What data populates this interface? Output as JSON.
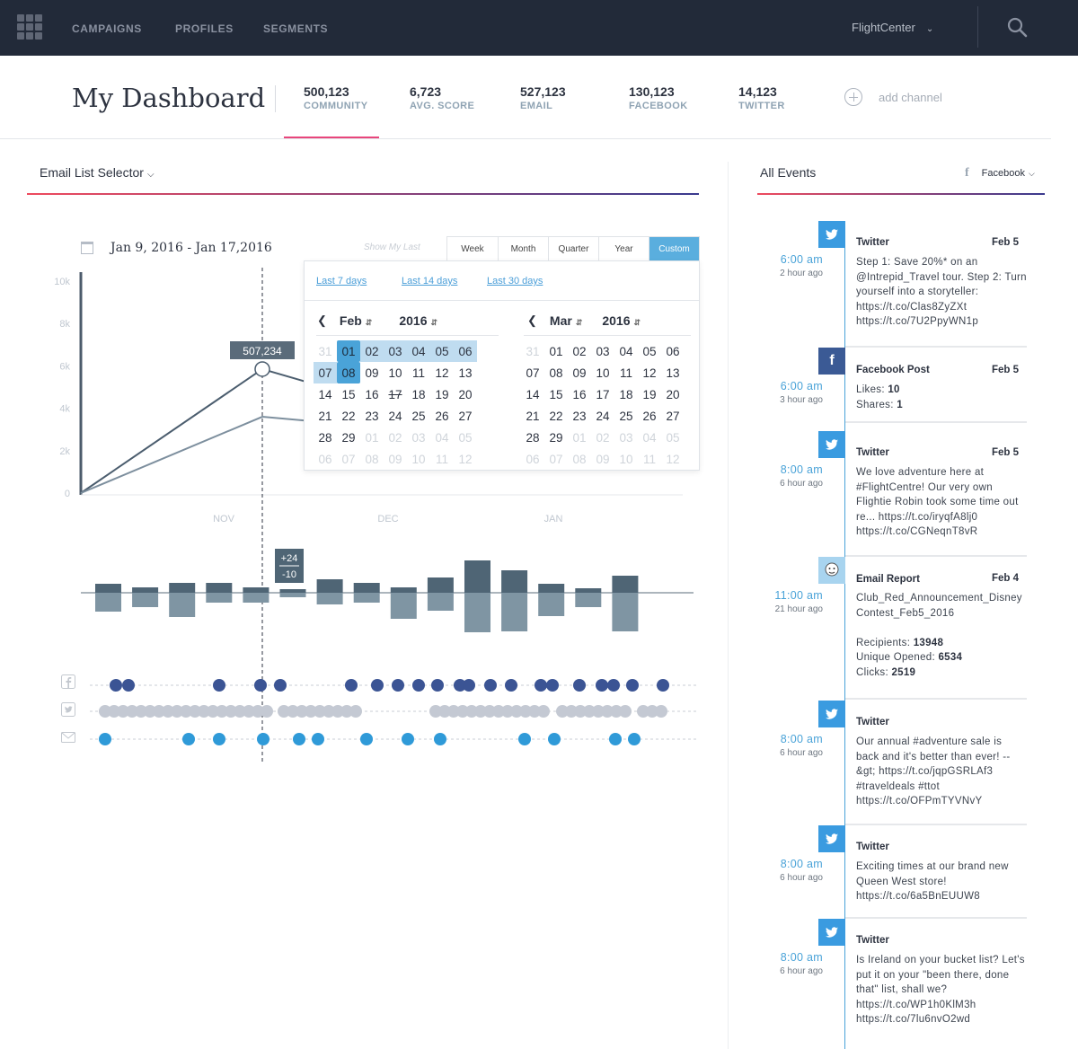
{
  "nav": {
    "links": [
      "CAMPAIGNS",
      "PROFILES",
      "SEGMENTS"
    ],
    "account": "FlightCenter"
  },
  "header": {
    "title": "My Dashboard",
    "stats": [
      {
        "value": "500,123",
        "label": "COMMUNITY"
      },
      {
        "value": "6,723",
        "label": "AVG. SCORE"
      },
      {
        "value": "527,123",
        "label": "EMAIL"
      },
      {
        "value": "130,123",
        "label": "FACEBOOK"
      },
      {
        "value": "14,123",
        "label": "TWITTER"
      }
    ],
    "add_channel": "add channel"
  },
  "left": {
    "list_selector": "Email List Selector",
    "date_range": "Jan 9, 2016 - Jan 17,2016",
    "show_my_last": "Show My Last",
    "range_buttons": [
      "Week",
      "Month",
      "Quarter",
      "Year",
      "Custom"
    ],
    "active_range": "Custom"
  },
  "picker": {
    "quick": [
      "Last 7 days",
      "Last 14 days",
      "Last 30 days"
    ],
    "left_month": "Feb",
    "left_year": "2016",
    "right_month": "Mar",
    "right_year": "2016",
    "feb_days": [
      "31",
      "01",
      "02",
      "03",
      "04",
      "05",
      "06",
      "07",
      "08",
      "09",
      "10",
      "11",
      "12",
      "13",
      "14",
      "15",
      "16",
      "17",
      "18",
      "19",
      "20",
      "21",
      "22",
      "23",
      "24",
      "25",
      "26",
      "27",
      "28",
      "29",
      "01",
      "02",
      "03",
      "04",
      "05",
      "06",
      "07",
      "08",
      "09",
      "10",
      "11",
      "12"
    ],
    "mar_days": [
      "31",
      "01",
      "02",
      "03",
      "04",
      "05",
      "06",
      "07",
      "08",
      "09",
      "10",
      "11",
      "12",
      "13",
      "14",
      "15",
      "16",
      "17",
      "18",
      "19",
      "20",
      "21",
      "22",
      "23",
      "24",
      "25",
      "26",
      "27",
      "28",
      "29",
      "01",
      "02",
      "03",
      "04",
      "05",
      "06",
      "07",
      "08",
      "09",
      "10",
      "11",
      "12"
    ]
  },
  "chart_data": {
    "type": "line",
    "x_labels": [
      "NOV",
      "DEC",
      "JAN"
    ],
    "y_ticks": [
      "0",
      "2k",
      "4k",
      "6k",
      "8k",
      "10k"
    ],
    "ylim": [
      0,
      10000
    ],
    "series": [
      {
        "values": [
          0,
          5850,
          5200
        ]
      },
      {
        "values": [
          0,
          3600,
          3400
        ]
      }
    ],
    "tooltip": "507,234",
    "bars_tooltip_up": "+24",
    "bars_tooltip_down": "-10",
    "bars": [
      {
        "up": 10,
        "down": 21
      },
      {
        "up": 6,
        "down": 16
      },
      {
        "up": 11,
        "down": 27
      },
      {
        "up": 11,
        "down": 11
      },
      {
        "up": 6,
        "down": 11
      },
      {
        "up": 4,
        "down": 5
      },
      {
        "up": 15,
        "down": 13
      },
      {
        "up": 11,
        "down": 11
      },
      {
        "up": 6,
        "down": 29
      },
      {
        "up": 17,
        "down": 20
      },
      {
        "up": 36,
        "down": 44
      },
      {
        "up": 25,
        "down": 43
      },
      {
        "up": 10,
        "down": 26
      },
      {
        "up": 5,
        "down": 16
      },
      {
        "up": 19,
        "down": 43
      }
    ],
    "facebook_dots": [
      129,
      143,
      244,
      290,
      312,
      391,
      420,
      443,
      466,
      487,
      512,
      522,
      546,
      569,
      602,
      615,
      645,
      670,
      683,
      704,
      738
    ],
    "twitter_dots_ranges": [
      [
        117,
        300
      ],
      [
        316,
        400
      ],
      [
        485,
        606
      ],
      [
        626,
        702
      ],
      [
        716,
        740
      ]
    ],
    "email_dots": [
      117,
      210,
      244,
      293,
      333,
      354,
      408,
      454,
      490,
      584,
      617,
      685,
      706
    ]
  },
  "events": {
    "title": "All Events",
    "filter": "Facebook",
    "items": [
      {
        "type": "twitter",
        "time": "6:00 am",
        "ago": "2 hour ago",
        "title": "Twitter",
        "date": "Feb 5",
        "lines": [
          "Step 1: Save 20%* on an @Intrepid_Travel tour. Step 2: Turn yourself into a storyteller: https://t.co/Clas8ZyZXt https://t.co/7U2PpyWN1p"
        ]
      },
      {
        "type": "facebook",
        "time": "6:00 am",
        "ago": "3 hour ago",
        "title": "Facebook Post",
        "date": "Feb 5",
        "likes_label": "Likes:",
        "likes": "10",
        "shares_label": "Shares:",
        "shares": "1"
      },
      {
        "type": "twitter",
        "time": "8:00 am",
        "ago": "6 hour ago",
        "title": "Twitter",
        "date": "Feb 5",
        "lines": [
          "We love adventure here at #FlightCentre! Our very own Flightie Robin took some time out re... https://t.co/iryqfA8lj0 https://t.co/CGNeqnT8vR"
        ]
      },
      {
        "type": "email",
        "time": "11:00 am",
        "ago": "21 hour ago",
        "title": "Email Report",
        "date": "Feb 4",
        "name": "Club_Red_Announcement_DisneyContest_Feb5_2016",
        "recipients_label": "Recipients:",
        "recipients": "13948",
        "opened_label": "Unique Opened:",
        "opened": "6534",
        "clicks_label": "Clicks:",
        "clicks": "2519"
      },
      {
        "type": "twitter",
        "time": "8:00 am",
        "ago": "6 hour ago",
        "title": "Twitter",
        "date": "",
        "lines": [
          "Our annual #adventure sale is back and it's better than ever! --&gt; https://t.co/jqpGSRLAf3 #traveldeals #ttot https://t.co/OFPmTYVNvY"
        ]
      },
      {
        "type": "twitter",
        "time": "8:00 am",
        "ago": "6 hour ago",
        "title": "Twitter",
        "date": "",
        "lines": [
          "Exciting times at our brand new Queen West store! https://t.co/6a5BnEUUW8"
        ]
      },
      {
        "type": "twitter",
        "time": "8:00 am",
        "ago": "6 hour ago",
        "title": "Twitter",
        "date": "",
        "lines": [
          "Is Ireland on your bucket list? Let's put it on your \"been there, done that\" list, shall we? https://t.co/WP1h0KlM3h https://t.co/7lu6nvO2wd"
        ]
      }
    ]
  },
  "colors": {
    "nav_bg": "#222a39",
    "accent_pink": "#e8467c",
    "accent_blue": "#4aa3d8",
    "twitter": "#3a9be0",
    "facebook": "#3b5a95"
  }
}
